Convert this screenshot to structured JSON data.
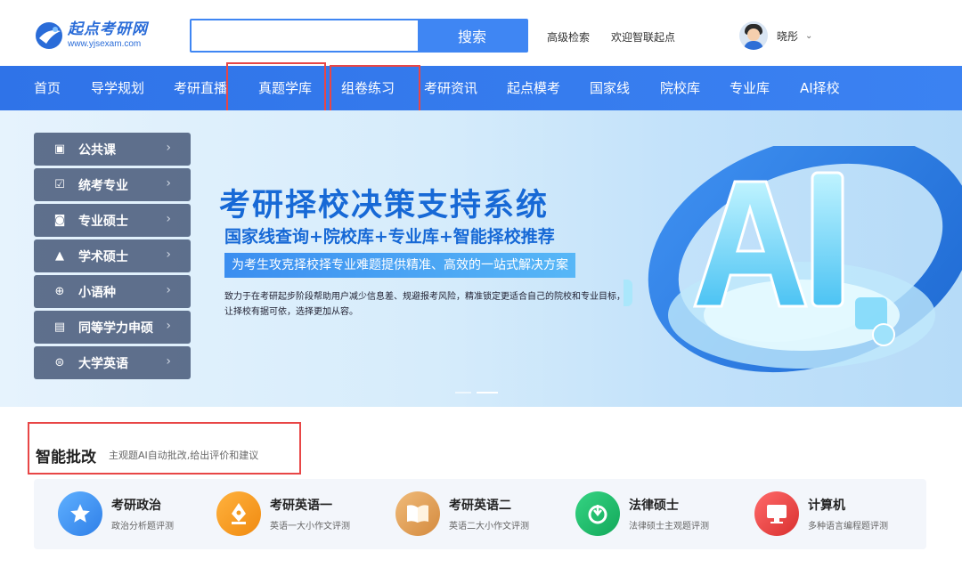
{
  "header": {
    "logo_name": "起点考研网",
    "logo_url": "www.yjsexam.com",
    "search_placeholder": "",
    "search_button": "搜索",
    "advanced_search": "高级检索",
    "welcome": "欢迎智联起点",
    "username": "晓彤",
    "caret": "⌄"
  },
  "nav": {
    "items": [
      "首页",
      "导学规划",
      "考研直播",
      "真题学库",
      "组卷练习",
      "考研资讯",
      "起点模考",
      "国家线",
      "院校库",
      "专业库",
      "AI择校"
    ]
  },
  "side_menu": {
    "items": [
      {
        "label": "公共课",
        "icon": "id-card-icon"
      },
      {
        "label": "统考专业",
        "icon": "checkbox-icon"
      },
      {
        "label": "专业硕士",
        "icon": "badge-icon"
      },
      {
        "label": "学术硕士",
        "icon": "graduation-cap-icon"
      },
      {
        "label": "小语种",
        "icon": "globe-icon"
      },
      {
        "label": "同等学力申硕",
        "icon": "book-icon"
      },
      {
        "label": "大学英语",
        "icon": "list-circle-icon"
      }
    ],
    "arrow": "›"
  },
  "banner": {
    "title": "考研择校决策支持系统",
    "subtitle": "国家线查询+院校库+专业库+智能择校推荐",
    "tag": "为考生攻克择校择专业难题提供精准、高效的一站式解决方案",
    "description": "致力于在考研起步阶段帮助用户减少信息差、规避报考风险，精准锁定更适合自己的院校和专业目标，让择校有据可依，选择更加从容。",
    "art_text": "AI"
  },
  "smart_grading": {
    "title": "智能批改",
    "description": "主观题AI自动批改,给出评价和建议",
    "cards": [
      {
        "title": "考研政治",
        "sub": "政治分析题评测",
        "icon": "star-icon",
        "color": "#3d8ef0"
      },
      {
        "title": "考研英语一",
        "sub": "英语一大小作文评测",
        "icon": "pen-nib-icon",
        "color": "#f29a1f"
      },
      {
        "title": "考研英语二",
        "sub": "英语二大小作文评测",
        "icon": "open-book-icon",
        "color": "#e0a15a"
      },
      {
        "title": "法律硕士",
        "sub": "法律硕士主观题评测",
        "icon": "law-badge-icon",
        "color": "#1fbf6a"
      },
      {
        "title": "计算机",
        "sub": "多种语言编程题评测",
        "icon": "monitor-icon",
        "color": "#e8474a"
      }
    ]
  },
  "colors": {
    "nav_bg": "#3079ea",
    "accent": "#3f86f3",
    "highlight_box": "#e84646"
  }
}
